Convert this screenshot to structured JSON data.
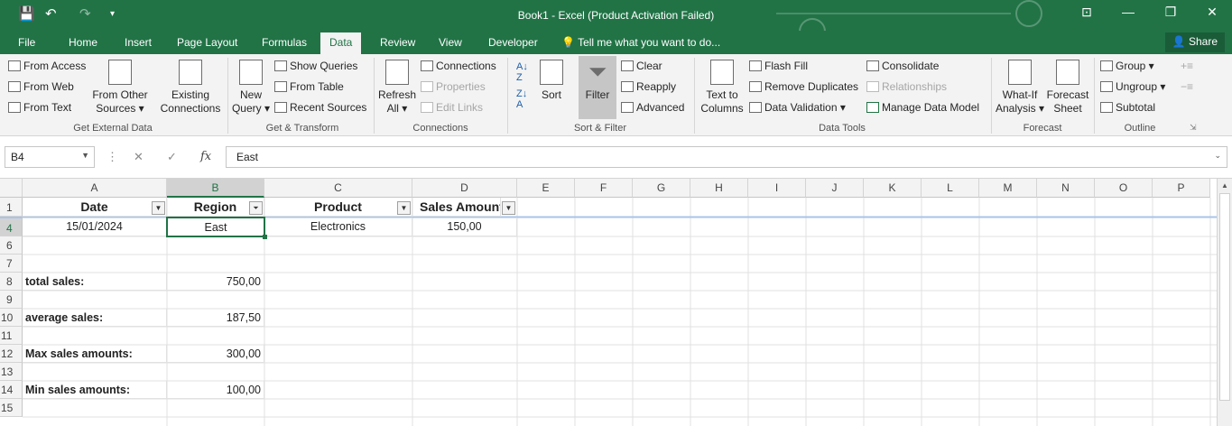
{
  "title": "Book1 - Excel (Product Activation Failed)",
  "window_controls": {
    "ribbon": "⊡",
    "min": "—",
    "restore": "❐",
    "close": "✕"
  },
  "tabs": [
    "File",
    "Home",
    "Insert",
    "Page Layout",
    "Formulas",
    "Data",
    "Review",
    "View",
    "Developer"
  ],
  "active_tab": "Data",
  "tell_me": "Tell me what you want to do...",
  "share": "Share",
  "ribbon": {
    "get_external": {
      "from_access": "From Access",
      "from_web": "From Web",
      "from_text": "From Text",
      "from_other_1": "From Other",
      "from_other_2": "Sources ▾",
      "existing_1": "Existing",
      "existing_2": "Connections",
      "label": "Get External Data"
    },
    "transform": {
      "new_query_1": "New",
      "new_query_2": "Query ▾",
      "show_queries": "Show Queries",
      "from_table": "From Table",
      "recent_sources": "Recent Sources",
      "label": "Get & Transform"
    },
    "connections": {
      "refresh_1": "Refresh",
      "refresh_2": "All ▾",
      "connections": "Connections",
      "properties": "Properties",
      "edit_links": "Edit Links",
      "label": "Connections"
    },
    "sort_filter": {
      "sort": "Sort",
      "filter": "Filter",
      "clear": "Clear",
      "reapply": "Reapply",
      "advanced": "Advanced",
      "label": "Sort & Filter"
    },
    "data_tools": {
      "t2c_1": "Text to",
      "t2c_2": "Columns",
      "flash_fill": "Flash Fill",
      "remove_duplicates": "Remove Duplicates",
      "data_validation": "Data Validation  ▾",
      "consolidate": "Consolidate",
      "relationships": "Relationships",
      "manage_model": "Manage Data Model",
      "label": "Data Tools"
    },
    "forecast": {
      "whatif_1": "What-If",
      "whatif_2": "Analysis ▾",
      "sheet_1": "Forecast",
      "sheet_2": "Sheet",
      "label": "Forecast"
    },
    "outline": {
      "group": "Group  ▾",
      "ungroup": "Ungroup  ▾",
      "subtotal": "Subtotal",
      "label": "Outline"
    }
  },
  "formula_bar": {
    "name_box": "B4",
    "fx": "fx",
    "value": "East"
  },
  "columns": [
    "A",
    "B",
    "C",
    "D",
    "E",
    "F",
    "G",
    "H",
    "I",
    "J",
    "K",
    "L",
    "M",
    "N",
    "O",
    "P"
  ],
  "rows": [
    "1",
    "4",
    "6",
    "7",
    "8",
    "9",
    "10",
    "11",
    "12",
    "13",
    "14",
    "15"
  ],
  "header_row": {
    "a": "Date",
    "b": "Region",
    "c": "Product",
    "d": "Sales Amount"
  },
  "row4": {
    "a": "15/01/2024",
    "b": "East",
    "c": "Electronics",
    "d": "150,00"
  },
  "stats": {
    "total_label": "total sales:",
    "total": "750,00",
    "avg_label": "average sales:",
    "avg": "187,50",
    "max_label": "Max sales amounts:",
    "max": "300,00",
    "min_label": "Min sales amounts:",
    "min": "100,00"
  }
}
